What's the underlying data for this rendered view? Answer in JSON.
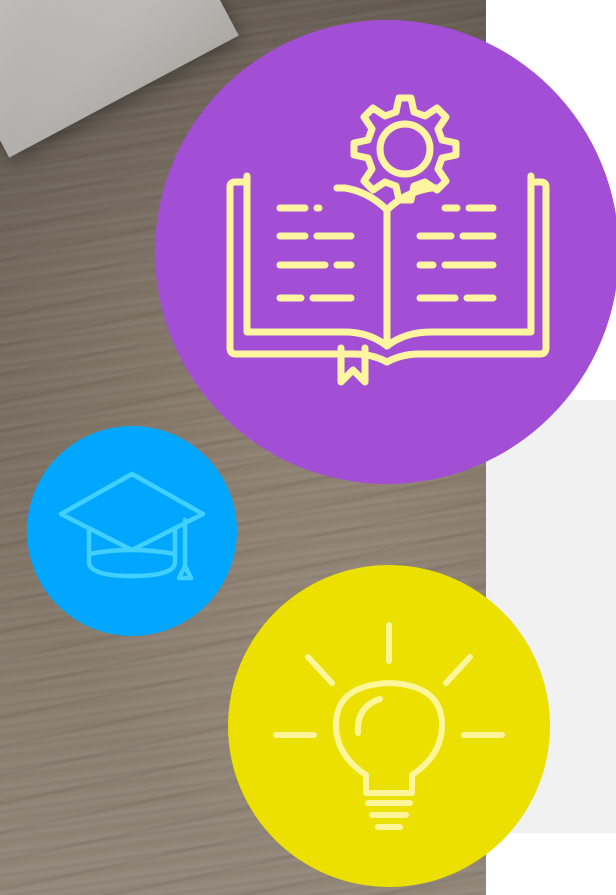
{
  "colors": {
    "purple_circle": "#a24fd6",
    "blue_circle": "#01a7ff",
    "yellow_circle": "#ece000",
    "purple_icon_stroke": "#fff5a0",
    "blue_icon_stroke": "#3fd0ff",
    "yellow_icon_stroke": "#fff59a",
    "side_panel": "#f1f1f1"
  },
  "background_photo": {
    "description_icon": "wood-texture-photo"
  },
  "icons": [
    {
      "name": "book-gear-icon",
      "circle": "purple"
    },
    {
      "name": "graduation-cap-icon",
      "circle": "blue"
    },
    {
      "name": "lightbulb-icon",
      "circle": "yellow"
    }
  ]
}
